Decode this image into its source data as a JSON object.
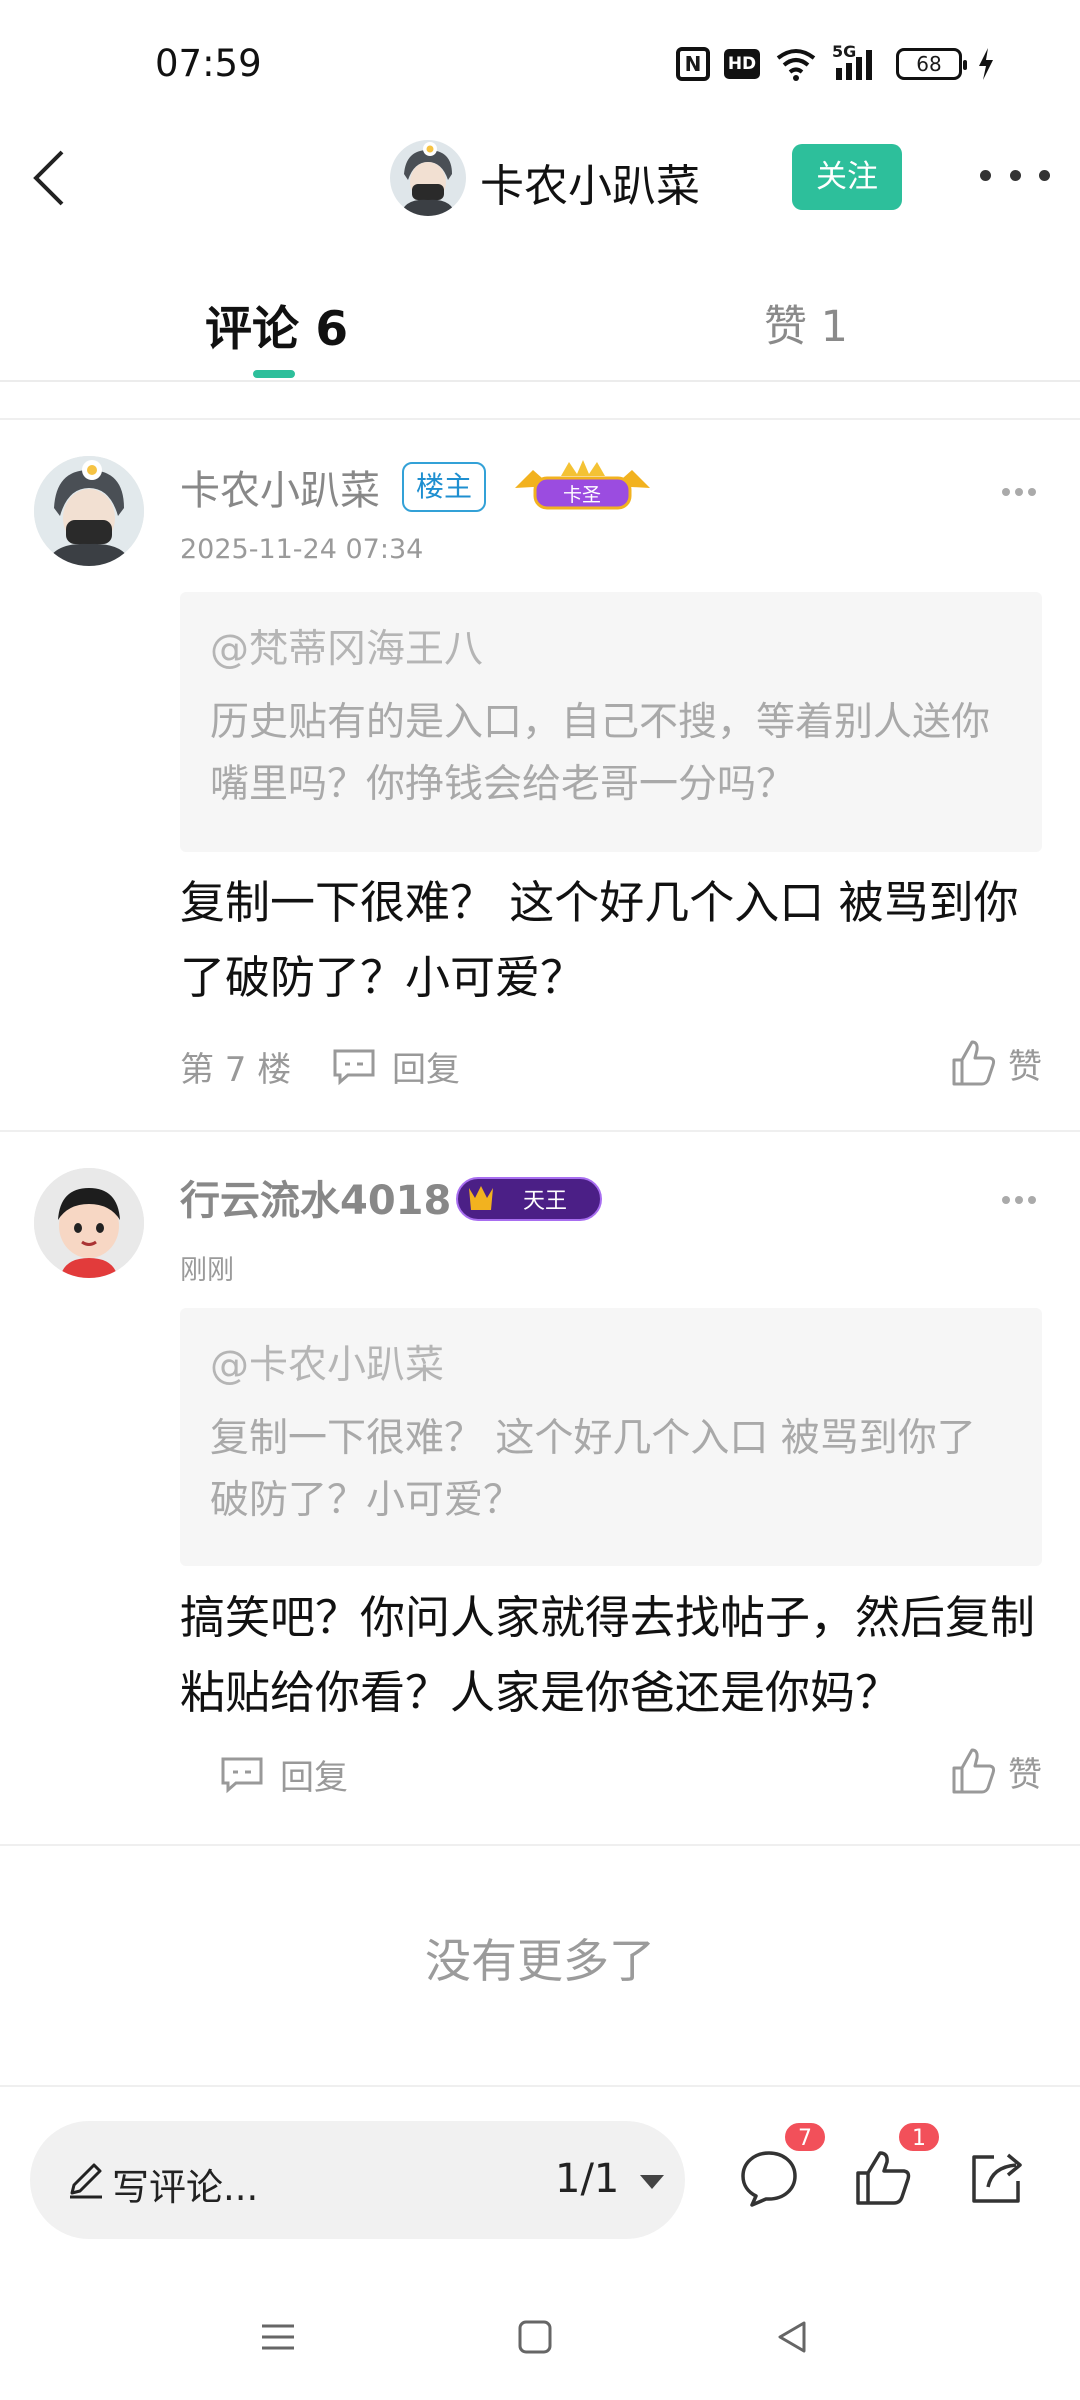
{
  "status_bar": {
    "time": "07:59",
    "icons": [
      "nfc-icon",
      "hd-icon",
      "wifi-icon",
      "signal-5g-icon",
      "battery-icon",
      "charging-icon"
    ],
    "battery_level": "68",
    "nfc_label": "N",
    "hd_label": "HD",
    "network_label": "5G"
  },
  "header": {
    "title": "卡农小趴菜",
    "follow_label": "关注",
    "accent_color": "#2dbf9b"
  },
  "tabs": {
    "comments_label": "评论 6",
    "likes_label": "赞 1"
  },
  "comments": [
    {
      "user": "卡农小趴菜",
      "owner_badge": "楼主",
      "level_badge": "卡圣",
      "time": "2025-11-24 07:34",
      "quote_user": "@梵蒂冈海王八",
      "quote_text": "历史贴有的是入口，自己不搜，等着别人送你嘴里吗？你挣钱会给老哥一分吗？",
      "body": "复制一下很难？ 这个好几个入口 被骂到你了破防了？小可爱？",
      "floor": "第 7 楼",
      "reply_label": "回复",
      "like_label": "赞"
    },
    {
      "user": "行云流水4018",
      "level_badge": "天王",
      "time": "刚刚",
      "quote_user": "@卡农小趴菜",
      "quote_text": "复制一下很难？ 这个好几个入口 被骂到你了破防了？小可爱？",
      "body": "搞笑吧？你问人家就得去找帖子，然后复制粘贴给你看？人家是你爸还是你妈？",
      "reply_label": "回复",
      "like_label": "赞"
    }
  ],
  "footer_note": "没有更多了",
  "bottom_bar": {
    "input_placeholder": "写评论...",
    "page_indicator": "1/1",
    "comment_count": "7",
    "like_count": "1",
    "badge_color": "#f2505a"
  }
}
